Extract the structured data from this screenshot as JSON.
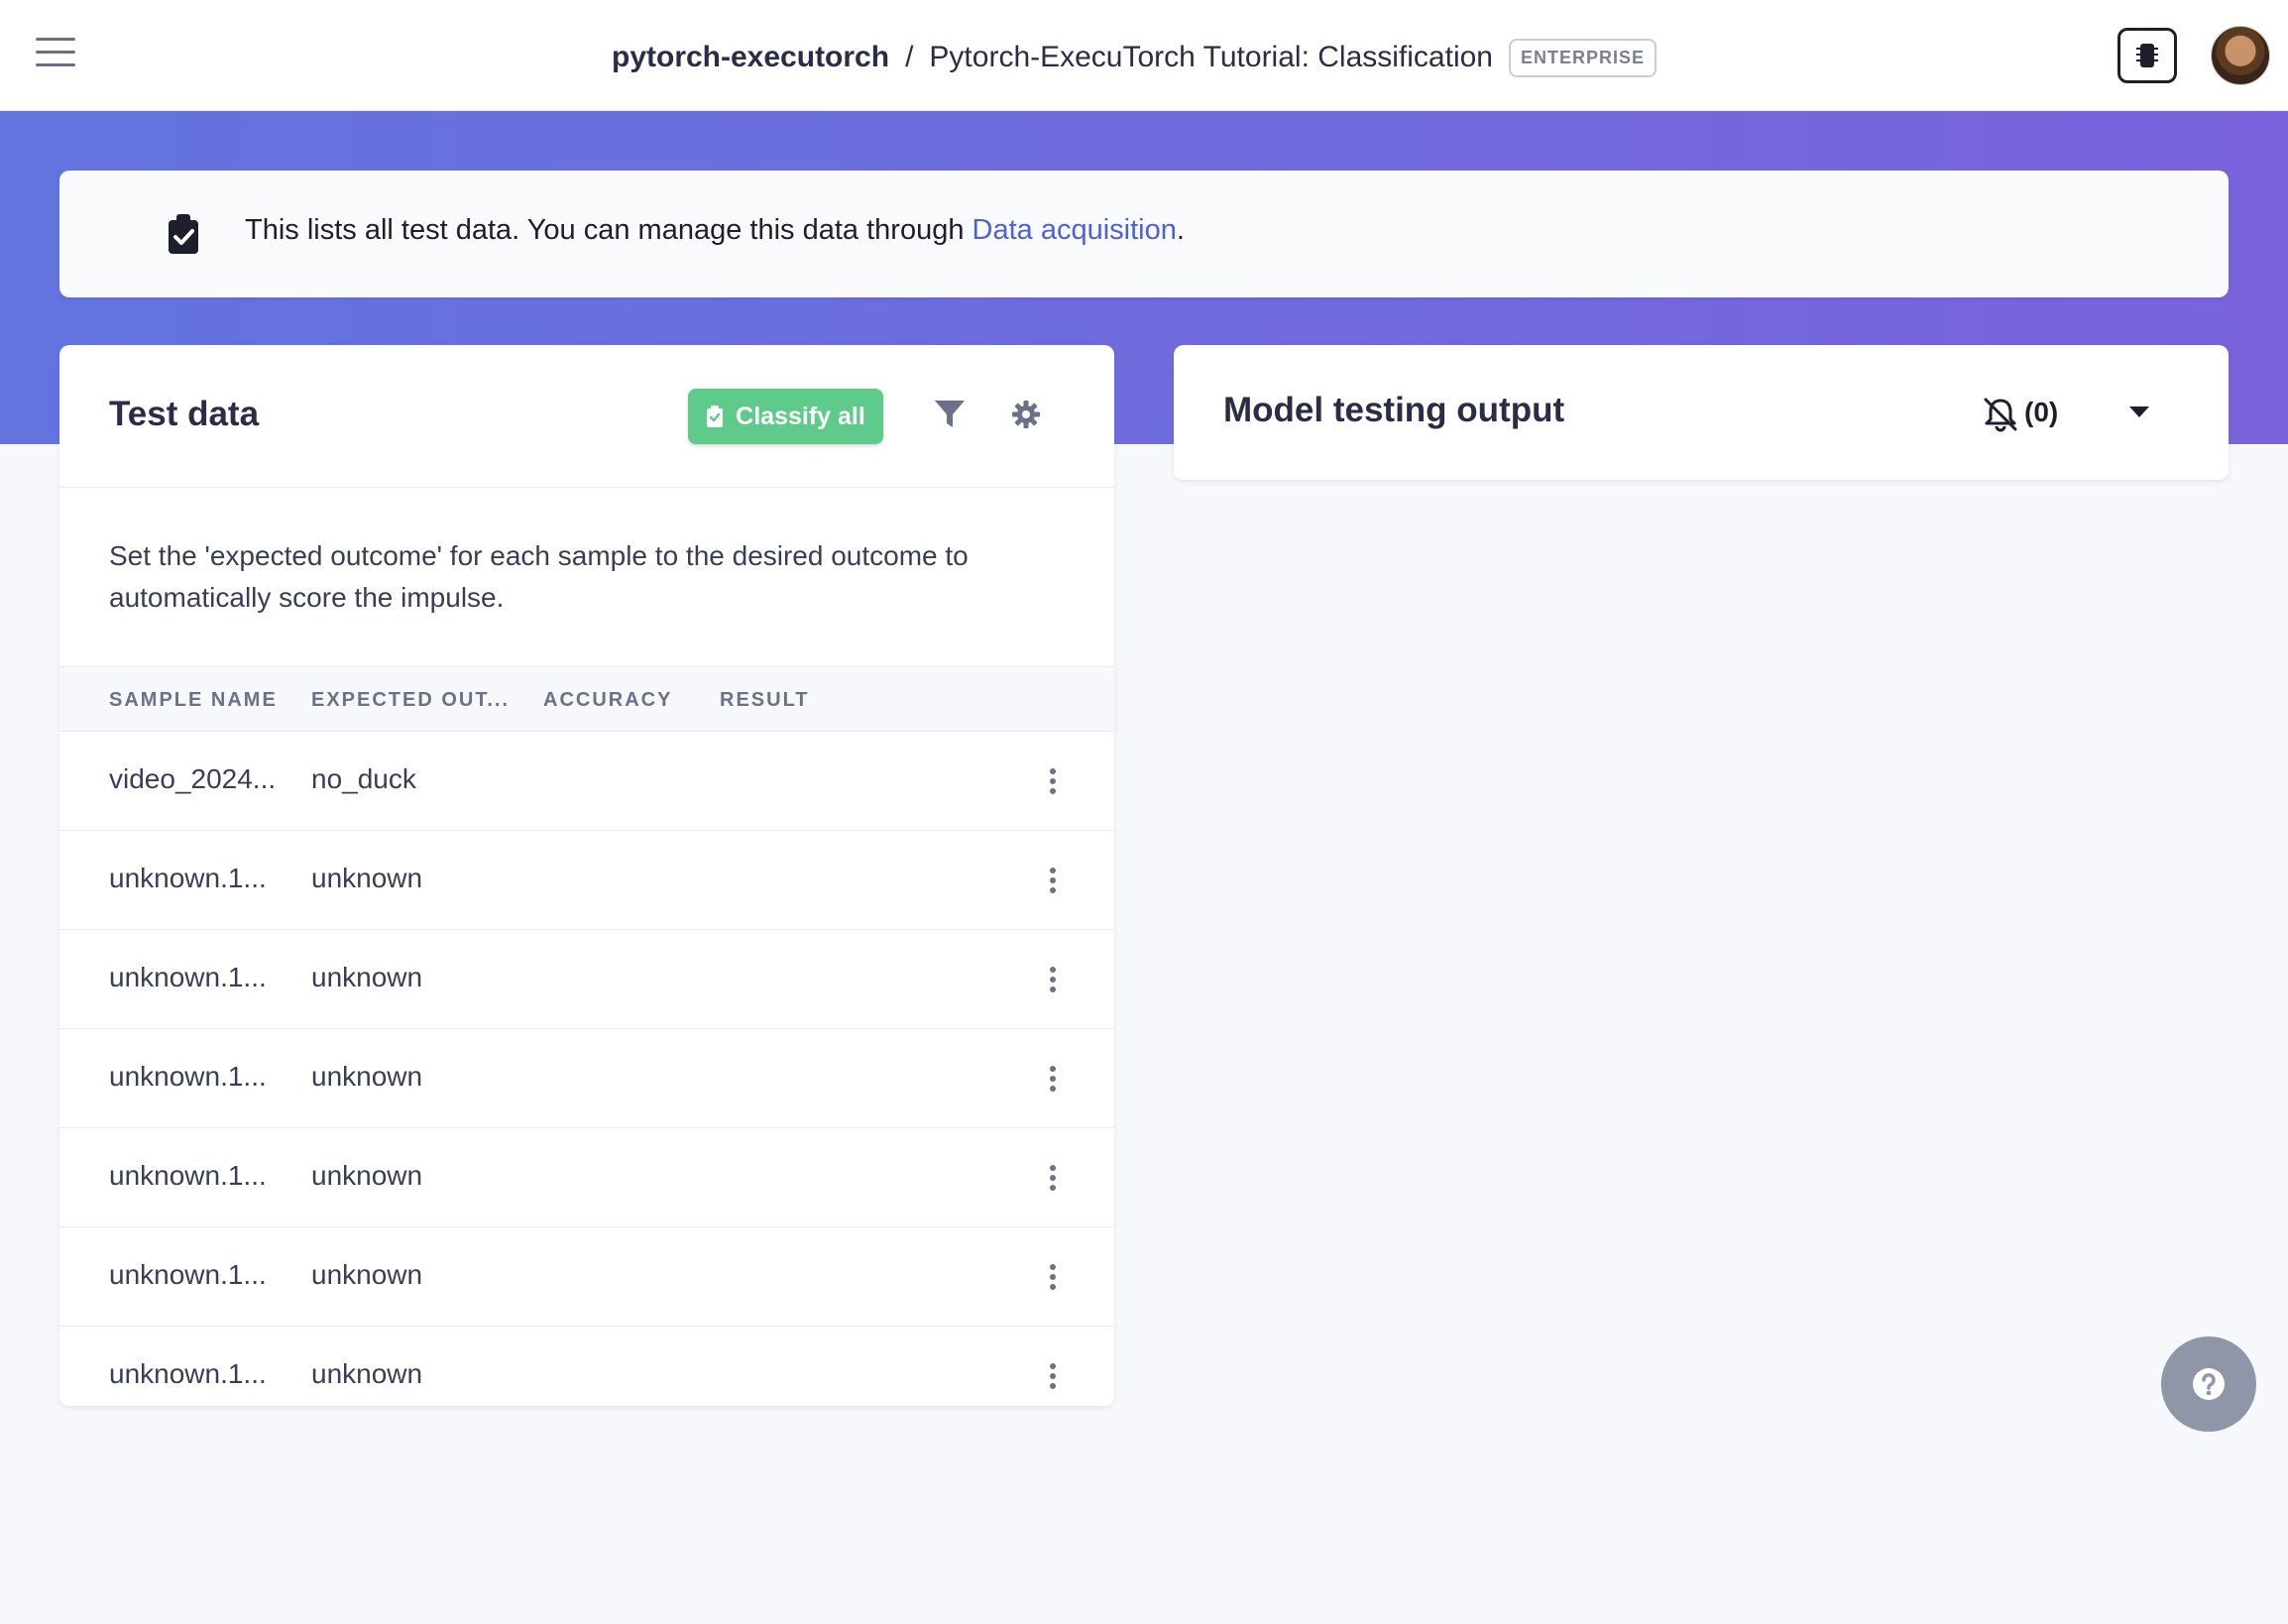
{
  "header": {
    "project": "pytorch-executorch",
    "separator": "/",
    "title": "Pytorch-ExecuTorch Tutorial: Classification",
    "badge": "ENTERPRISE"
  },
  "info": {
    "text_before": "This lists all test data. You can manage this data through ",
    "link": "Data acquisition",
    "text_after": "."
  },
  "test_data": {
    "title": "Test data",
    "classify_all_label": "Classify all",
    "description": "Set the 'expected outcome' for each sample to the desired outcome to automatically score the impulse.",
    "columns": [
      "SAMPLE NAME",
      "EXPECTED OUT...",
      "ACCURACY",
      "RESULT"
    ],
    "rows": [
      {
        "sample": "video_2024...",
        "expected": "no_duck"
      },
      {
        "sample": "unknown.1...",
        "expected": "unknown"
      },
      {
        "sample": "unknown.1...",
        "expected": "unknown"
      },
      {
        "sample": "unknown.1...",
        "expected": "unknown"
      },
      {
        "sample": "unknown.1...",
        "expected": "unknown"
      },
      {
        "sample": "unknown.1...",
        "expected": "unknown"
      },
      {
        "sample": "unknown.1...",
        "expected": "unknown"
      }
    ]
  },
  "model_output": {
    "title": "Model testing output",
    "notification_count": "(0)"
  },
  "colors": {
    "accent": "#4c61d9",
    "classify_button": "#5ecb8a",
    "band_start": "#6374de",
    "band_end": "#7a63dc"
  }
}
